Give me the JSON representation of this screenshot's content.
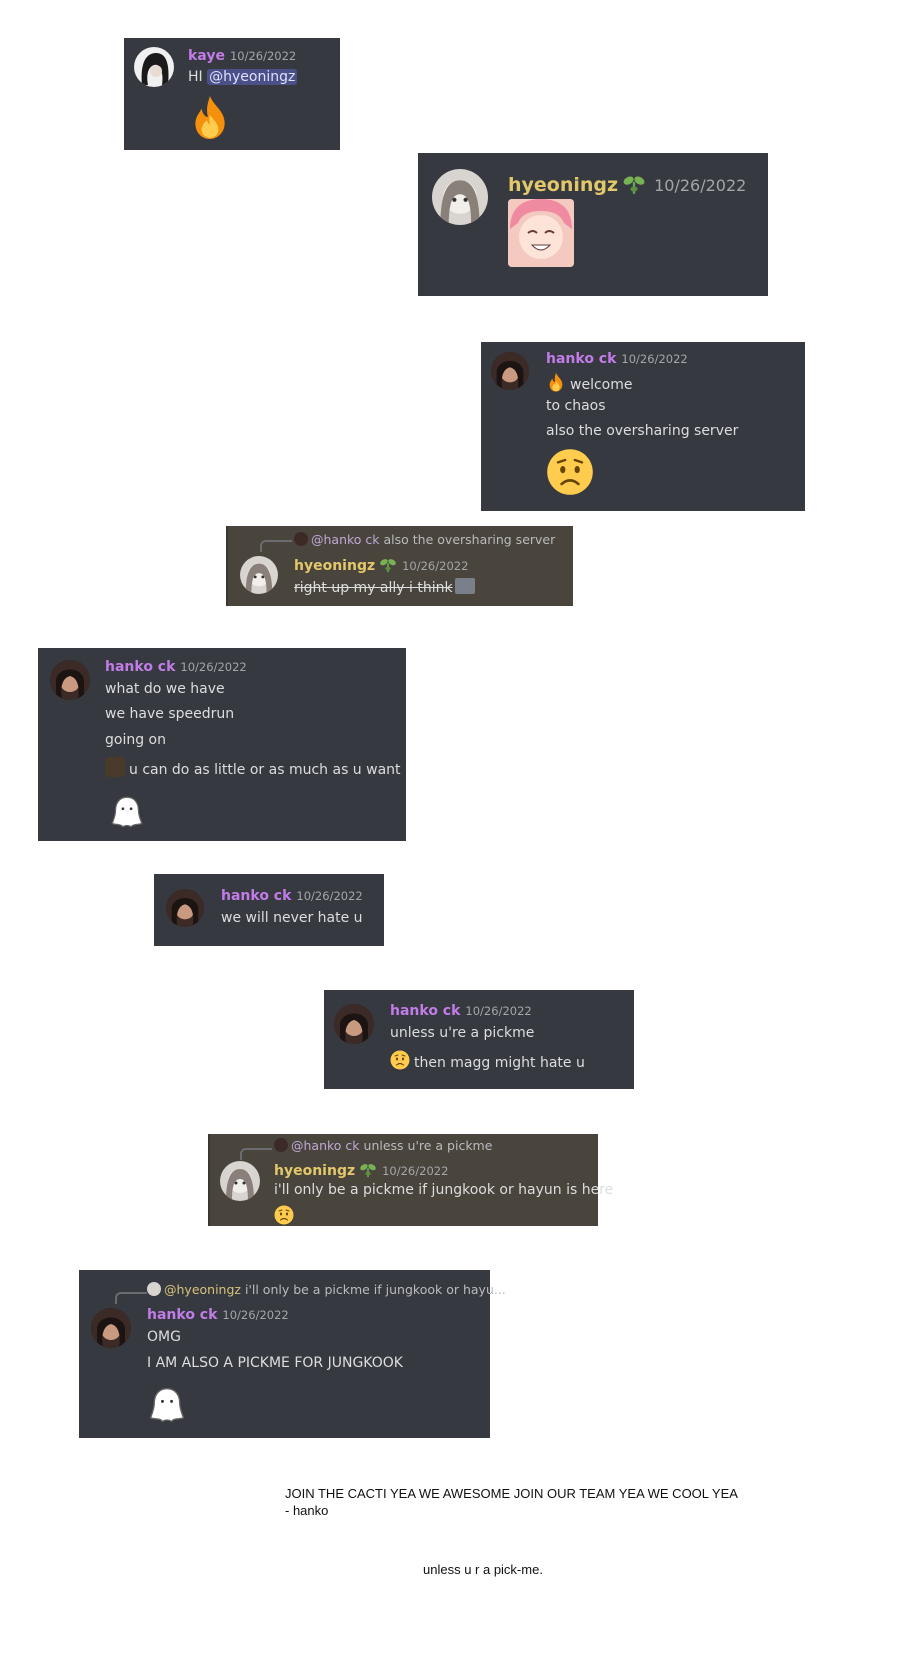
{
  "messages": [
    {
      "name": "kaye",
      "ts": "10/26/2022",
      "text_pre": "HI ",
      "mention": "@hyeoningz",
      "emoji": "fire-emoji"
    },
    {
      "name": "hyeoningz",
      "ts": "10/26/2022",
      "sticker": "anime-girl-smiling-sticker"
    },
    {
      "name": "hanko ck",
      "ts": "10/26/2022",
      "lines": [
        "welcome",
        "to chaos",
        "also the oversharing server"
      ],
      "emoji": "worried-face-emoji"
    },
    {
      "reply_name": "@hanko ck",
      "reply_text": "also the oversharing server",
      "name": "hyeoningz",
      "ts": "10/26/2022",
      "text": "right up my ally i think"
    },
    {
      "name": "hanko ck",
      "ts": "10/26/2022",
      "lines": [
        "what do we have",
        "we have speedrun",
        "going on",
        "u can do as little or as much as u want"
      ],
      "sticker": "cute-blob-sticker"
    },
    {
      "name": "hanko ck",
      "ts": "10/26/2022",
      "text": "we will never hate u"
    },
    {
      "name": "hanko ck",
      "ts": "10/26/2022",
      "lines": [
        "unless u're a pickme",
        "then magg might hate u"
      ]
    },
    {
      "reply_name": "@hanko ck",
      "reply_text": "unless u're a pickme",
      "name": "hyeoningz",
      "ts": "10/26/2022",
      "text": "i'll only be a pickme if jungkook or hayun is here"
    },
    {
      "reply_name": "@hyeoningz",
      "reply_text": "i'll only be a pickme if jungkook or hayu...",
      "name": "hanko ck",
      "ts": "10/26/2022",
      "lines": [
        "OMG",
        "I AM ALSO A PICKME FOR JUNGKOOK"
      ],
      "sticker": "cute-blob-sticker"
    }
  ],
  "footer": {
    "line1": "JOIN THE CACTI YEA WE AWESOME JOIN OUR TEAM YEA WE COOL YEA",
    "line2": "- hanko",
    "line3": "unless u r a pick-me."
  },
  "colors": {
    "card": "#36393f",
    "highlight": "#49443c",
    "pink_name": "#c27ce8",
    "gold_name": "#e3c86b"
  }
}
